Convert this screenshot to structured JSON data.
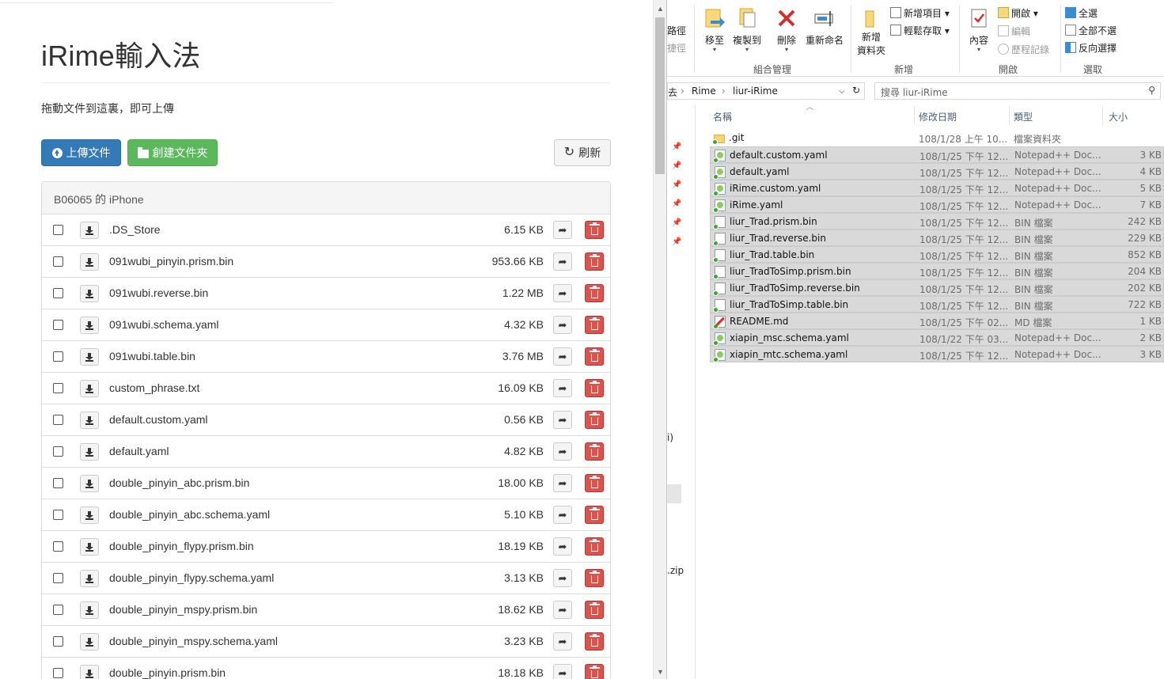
{
  "browser": {
    "title": "iRime輸入法",
    "drop_hint": "拖動文件到這裏，即可上傳",
    "buttons": {
      "upload": "上傳文件",
      "new_folder": "創建文件夾",
      "refresh": "刷新"
    },
    "panel_title": "B06065 的 iPhone",
    "files": [
      {
        "name": ".DS_Store",
        "size": "6.15 KB"
      },
      {
        "name": "091wubi_pinyin.prism.bin",
        "size": "953.66 KB"
      },
      {
        "name": "091wubi.reverse.bin",
        "size": "1.22 MB"
      },
      {
        "name": "091wubi.schema.yaml",
        "size": "4.32 KB"
      },
      {
        "name": "091wubi.table.bin",
        "size": "3.76 MB"
      },
      {
        "name": "custom_phrase.txt",
        "size": "16.09 KB"
      },
      {
        "name": "default.custom.yaml",
        "size": "0.56 KB"
      },
      {
        "name": "default.yaml",
        "size": "4.82 KB"
      },
      {
        "name": "double_pinyin_abc.prism.bin",
        "size": "18.00 KB"
      },
      {
        "name": "double_pinyin_abc.schema.yaml",
        "size": "5.10 KB"
      },
      {
        "name": "double_pinyin_flypy.prism.bin",
        "size": "18.19 KB"
      },
      {
        "name": "double_pinyin_flypy.schema.yaml",
        "size": "3.13 KB"
      },
      {
        "name": "double_pinyin_mspy.prism.bin",
        "size": "18.62 KB"
      },
      {
        "name": "double_pinyin_mspy.schema.yaml",
        "size": "3.23 KB"
      },
      {
        "name": "double_pinyin.prism.bin",
        "size": "18.18 KB"
      }
    ]
  },
  "explorer": {
    "ribbon": {
      "path_cut_1": "路徑",
      "path_cut_2": "捷徑",
      "move_to": "移至",
      "copy_to": "複製到",
      "delete": "刪除",
      "rename": "重新命名",
      "new_folder_1": "新增",
      "new_folder_2": "資料夾",
      "new_item": "新增項目",
      "easy_access": "輕鬆存取",
      "properties": "內容",
      "open": "開啟",
      "edit": "編輯",
      "history": "歷程記錄",
      "select_all": "全選",
      "select_none": "全部不選",
      "invert_selection": "反向選擇",
      "group_organize": "組合管理",
      "group_new": "新增",
      "group_open": "開啟",
      "group_select": "選取"
    },
    "address": {
      "prefix": "去",
      "crumb1": "Rime",
      "crumb2": "liur-iRime"
    },
    "search_placeholder": "搜尋 liur-iRime",
    "columns": {
      "name": "名稱",
      "date": "修改日期",
      "type": "類型",
      "size": "大小"
    },
    "left_edge_texts": {
      "a": "i)",
      "b": ".zip"
    },
    "files": [
      {
        "name": ".git",
        "date": "108/1/28 上午 10...",
        "type": "檔案資料夾",
        "size": "",
        "icon": "folder-icon",
        "selected": false
      },
      {
        "name": "default.custom.yaml",
        "date": "108/1/25 下午 12...",
        "type": "Notepad++ Doc...",
        "size": "3 KB",
        "icon": "notepad-file-icon",
        "selected": true
      },
      {
        "name": "default.yaml",
        "date": "108/1/25 下午 12...",
        "type": "Notepad++ Doc...",
        "size": "4 KB",
        "icon": "notepad-file-icon",
        "selected": true
      },
      {
        "name": "iRime.custom.yaml",
        "date": "108/1/25 下午 12...",
        "type": "Notepad++ Doc...",
        "size": "5 KB",
        "icon": "notepad-file-icon",
        "selected": true
      },
      {
        "name": "iRime.yaml",
        "date": "108/1/25 下午 12...",
        "type": "Notepad++ Doc...",
        "size": "7 KB",
        "icon": "notepad-file-icon",
        "selected": true
      },
      {
        "name": "liur_Trad.prism.bin",
        "date": "108/1/25 下午 12...",
        "type": "BIN 檔案",
        "size": "242 KB",
        "icon": "bin-file-icon",
        "selected": true
      },
      {
        "name": "liur_Trad.reverse.bin",
        "date": "108/1/25 下午 12...",
        "type": "BIN 檔案",
        "size": "229 KB",
        "icon": "bin-file-icon",
        "selected": true
      },
      {
        "name": "liur_Trad.table.bin",
        "date": "108/1/25 下午 12...",
        "type": "BIN 檔案",
        "size": "852 KB",
        "icon": "bin-file-icon",
        "selected": true
      },
      {
        "name": "liur_TradToSimp.prism.bin",
        "date": "108/1/25 下午 12...",
        "type": "BIN 檔案",
        "size": "204 KB",
        "icon": "bin-file-icon",
        "selected": true
      },
      {
        "name": "liur_TradToSimp.reverse.bin",
        "date": "108/1/25 下午 12...",
        "type": "BIN 檔案",
        "size": "202 KB",
        "icon": "bin-file-icon",
        "selected": true
      },
      {
        "name": "liur_TradToSimp.table.bin",
        "date": "108/1/25 下午 12...",
        "type": "BIN 檔案",
        "size": "722 KB",
        "icon": "bin-file-icon",
        "selected": true
      },
      {
        "name": "README.md",
        "date": "108/1/25 下午 02...",
        "type": "MD 檔案",
        "size": "1 KB",
        "icon": "markdown-file-icon",
        "selected": true
      },
      {
        "name": "xiapin_msc.schema.yaml",
        "date": "108/1/22 下午 03...",
        "type": "Notepad++ Doc...",
        "size": "2 KB",
        "icon": "notepad-file-icon",
        "selected": true
      },
      {
        "name": "xiapin_mtc.schema.yaml",
        "date": "108/1/25 下午 12...",
        "type": "Notepad++ Doc...",
        "size": "3 KB",
        "icon": "notepad-file-icon",
        "selected": true
      }
    ]
  },
  "colors": {
    "primary_button": "#337ab7",
    "success_button": "#5cb85c",
    "danger_button": "#d9534f",
    "selection": "#d9d9d9"
  }
}
